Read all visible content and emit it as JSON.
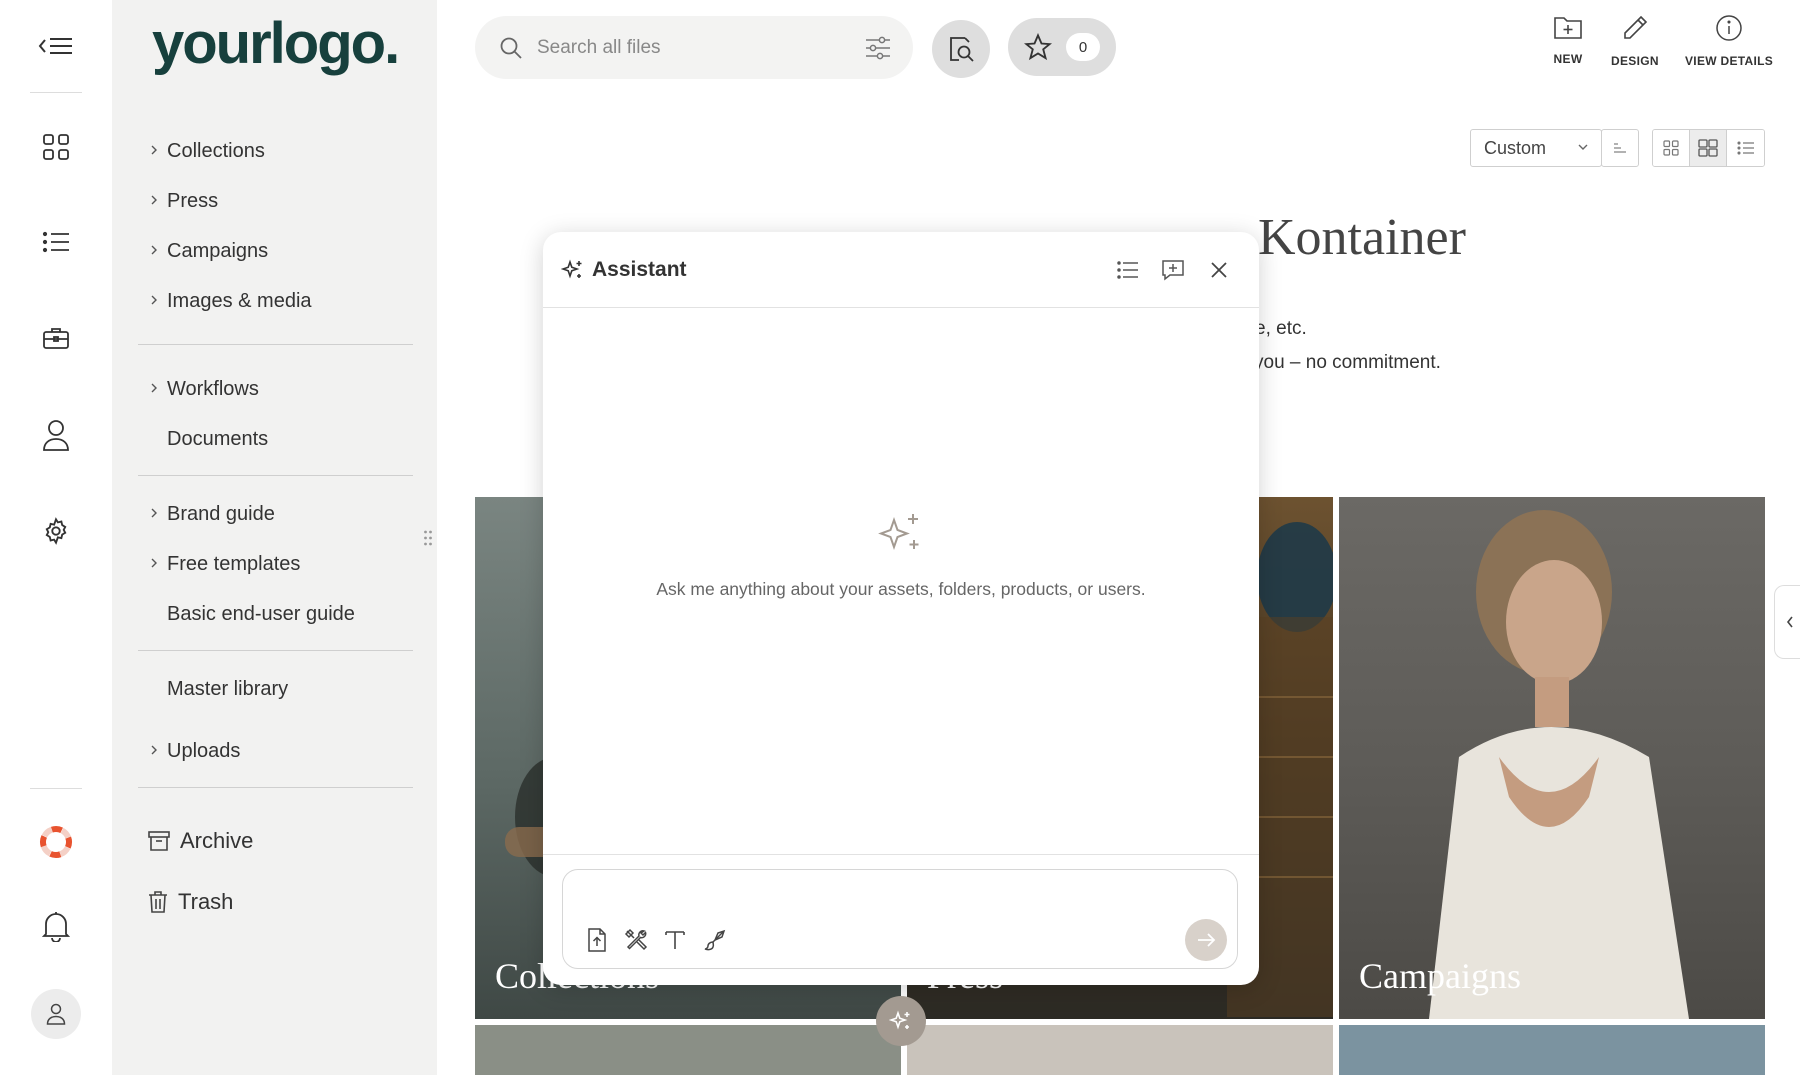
{
  "rail": {
    "icons": [
      "menu-collapse-icon",
      "dashboard-grid-icon",
      "list-icon",
      "briefcase-icon",
      "user-icon",
      "settings-gear-icon",
      "help-lifebuoy-icon",
      "bell-icon",
      "avatar-user-icon"
    ],
    "help_color": "#e8532f"
  },
  "sidebar": {
    "logo": "yourlogo.",
    "logo_color": "#17403d",
    "items": [
      {
        "label": "Collections"
      },
      {
        "label": "Press"
      },
      {
        "label": "Campaigns"
      },
      {
        "label": "Images & media"
      },
      {
        "label": "Workflows"
      },
      {
        "label": "Documents"
      },
      {
        "label": "Brand guide"
      },
      {
        "label": "Free templates"
      },
      {
        "label": "Basic end-user guide"
      },
      {
        "label": "Master library"
      },
      {
        "label": "Uploads"
      }
    ],
    "archive_label": "Archive",
    "trash_label": "Trash"
  },
  "topbar": {
    "search_placeholder": "Search all files",
    "favorites_count": "0",
    "new_label": "NEW",
    "design_label": "DESIGN",
    "details_label": "VIEW DETAILS"
  },
  "view": {
    "sort_selected": "Custom"
  },
  "welcome": {
    "title_visible": "Kontainer",
    "line1_visible": "e, etc.",
    "line2_visible": "you – no commitment."
  },
  "tiles": [
    {
      "label": "Collections",
      "color": "#5c6864"
    },
    {
      "label": "Press",
      "color": "#3d3a33"
    },
    {
      "label": "Campaigns",
      "color": "#5e5c58"
    }
  ],
  "assistant": {
    "title": "Assistant",
    "empty_text": "Ask me anything about your assets, folders, products, or users.",
    "input_value": "",
    "accent": "#a39a91"
  }
}
